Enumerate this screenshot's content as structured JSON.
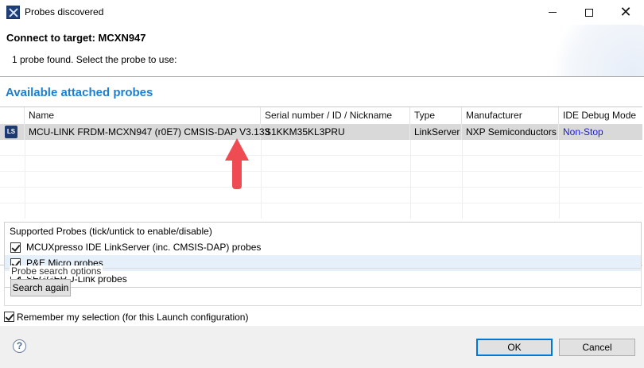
{
  "window": {
    "title": "Probes discovered"
  },
  "header": {
    "title": "Connect to target: MCXN947",
    "message": "1 probe found. Select the probe to use:"
  },
  "probes": {
    "section_title": "Available attached probes",
    "columns": [
      "Name",
      "Serial number / ID / Nickname",
      "Type",
      "Manufacturer",
      "IDE Debug Mode"
    ],
    "rows": [
      {
        "icon": "LS",
        "name": "MCU-LINK FRDM-MCXN947 (r0E7) CMSIS-DAP V3.133",
        "serial": "S1KKM35KL3PRU",
        "type": "LinkServer",
        "manufacturer": "NXP Semiconductors",
        "debug_mode": "Non-Stop"
      }
    ]
  },
  "supported": {
    "title": "Supported Probes (tick/untick to enable/disable)",
    "items": [
      {
        "label": "MCUXpresso IDE LinkServer (inc. CMSIS-DAP) probes",
        "checked": true
      },
      {
        "label": "P&E Micro probes",
        "checked": true
      },
      {
        "label": "SEGGER J-Link probes",
        "checked": true
      }
    ]
  },
  "search": {
    "group_title": "Probe search options",
    "button_label": "Search again"
  },
  "remember": {
    "label": "Remember my selection (for this Launch configuration)",
    "checked": true
  },
  "footer": {
    "ok_label": "OK",
    "cancel_label": "Cancel",
    "help_symbol": "?"
  },
  "colors": {
    "section_title": "#1a7fd0",
    "link": "#1a1adb",
    "arrow": "#ef4b53",
    "selected_row": "#d9d9d9"
  }
}
